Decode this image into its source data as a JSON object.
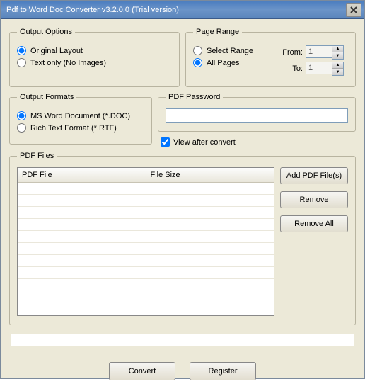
{
  "titlebar": {
    "title": "Pdf to Word Doc Converter v3.2.0.0 (Trial version)"
  },
  "outputOptions": {
    "legend": "Output Options",
    "originalLayout": "Original Layout",
    "textOnly": "Text only (No Images)"
  },
  "pageRange": {
    "legend": "Page Range",
    "selectRange": "Select Range",
    "allPages": "All Pages",
    "fromLabel": "From:",
    "toLabel": "To:",
    "fromValue": "1",
    "toValue": "1"
  },
  "outputFormats": {
    "legend": "Output Formats",
    "doc": "MS Word Document (*.DOC)",
    "rtf": "Rich Text Format (*.RTF)"
  },
  "pdfPassword": {
    "legend": "PDF Password",
    "value": ""
  },
  "viewAfter": {
    "label": "View after convert"
  },
  "pdfFiles": {
    "legend": "PDF Files",
    "colFile": "PDF File",
    "colSize": "File Size",
    "addBtn": "Add PDF File(s)",
    "removeBtn": "Remove",
    "removeAllBtn": "Remove All"
  },
  "bottom": {
    "convert": "Convert",
    "register": "Register"
  }
}
